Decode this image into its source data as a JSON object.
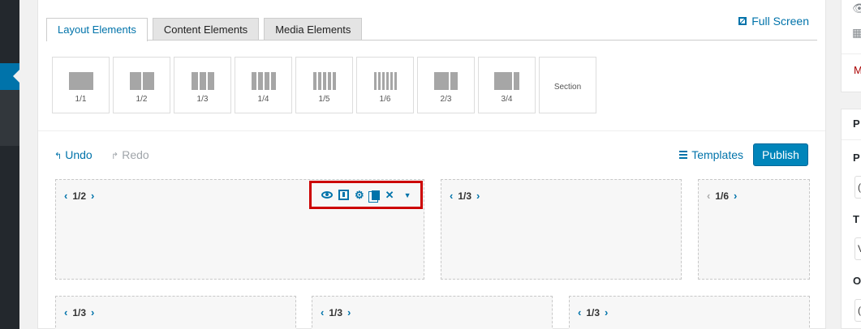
{
  "tabs": [
    {
      "label": "Layout Elements",
      "active": true
    },
    {
      "label": "Content Elements",
      "active": false
    },
    {
      "label": "Media Elements",
      "active": false
    }
  ],
  "fullscreen_label": "Full Screen",
  "elements": [
    {
      "label": "1/1",
      "cols": 1
    },
    {
      "label": "1/2",
      "cols": 2
    },
    {
      "label": "1/3",
      "cols": 3
    },
    {
      "label": "1/4",
      "cols": 4
    },
    {
      "label": "1/5",
      "cols": 5
    },
    {
      "label": "1/6",
      "cols": 6
    },
    {
      "label": "2/3",
      "cols": 2
    },
    {
      "label": "3/4",
      "cols": 2
    },
    {
      "label": "Section",
      "cols": 0
    }
  ],
  "undo_label": "Undo",
  "redo_label": "Redo",
  "templates_label": "Templates",
  "publish_label": "Publish",
  "columns_row1": [
    {
      "size": "1/2",
      "prev_disabled": false
    },
    {
      "size": "1/3",
      "prev_disabled": false
    },
    {
      "size": "1/6",
      "prev_disabled": true
    }
  ],
  "columns_row2": [
    {
      "size": "1/3"
    },
    {
      "size": "1/3"
    },
    {
      "size": "1/3"
    }
  ],
  "toolbar_icons": [
    "eye-icon",
    "save-template-icon",
    "gear-icon",
    "clone-icon",
    "close-icon",
    "caret-down-icon"
  ],
  "right_sidebar": {
    "red_text": "M",
    "labels": [
      "P",
      "P",
      "T",
      "O"
    ],
    "field_values": [
      "(",
      "V",
      "("
    ]
  },
  "colors": {
    "accent": "#0073aa",
    "publish": "#0085ba",
    "highlight": "#cc0000",
    "admin_bar": "#23282d"
  }
}
